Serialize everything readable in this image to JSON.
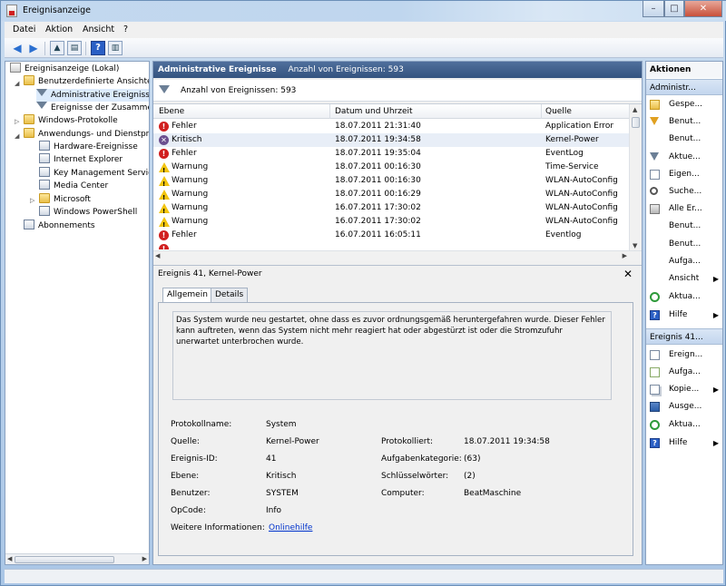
{
  "window": {
    "title": "Ereignisanzeige"
  },
  "menu": [
    "Datei",
    "Aktion",
    "Ansicht",
    "?"
  ],
  "tree": {
    "root": "Ereignisanzeige (Lokal)",
    "custom_views": "Benutzerdefinierte Ansichten",
    "admin_events": "Administrative Ereignisse",
    "summary_events": "Ereignisse der Zusammen",
    "windows_logs": "Windows-Protokolle",
    "app_services": "Anwendungs- und Dienstpro",
    "hardware": "Hardware-Ereignisse",
    "ie": "Internet Explorer",
    "kms": "Key Management Service",
    "media_center": "Media Center",
    "microsoft": "Microsoft",
    "powershell": "Windows PowerShell",
    "subscriptions": "Abonnements"
  },
  "center": {
    "header_title": "Administrative Ereignisse",
    "header_count": "Anzahl von Ereignissen: 593",
    "filter_text": "Anzahl von Ereignissen: 593",
    "columns": {
      "level": "Ebene",
      "datetime": "Datum und Uhrzeit",
      "source": "Quelle"
    },
    "rows": [
      {
        "level": "Fehler",
        "type": "error",
        "datetime": "18.07.2011 21:31:40",
        "source": "Application Error"
      },
      {
        "level": "Kritisch",
        "type": "critical",
        "datetime": "18.07.2011 19:34:58",
        "source": "Kernel-Power"
      },
      {
        "level": "Fehler",
        "type": "error",
        "datetime": "18.07.2011 19:35:04",
        "source": "EventLog"
      },
      {
        "level": "Warnung",
        "type": "warn",
        "datetime": "18.07.2011 00:16:30",
        "source": "Time-Service"
      },
      {
        "level": "Warnung",
        "type": "warn",
        "datetime": "18.07.2011 00:16:30",
        "source": "WLAN-AutoConfig"
      },
      {
        "level": "Warnung",
        "type": "warn",
        "datetime": "18.07.2011 00:16:29",
        "source": "WLAN-AutoConfig"
      },
      {
        "level": "Warnung",
        "type": "warn",
        "datetime": "16.07.2011 17:30:02",
        "source": "WLAN-AutoConfig"
      },
      {
        "level": "Warnung",
        "type": "warn",
        "datetime": "16.07.2011 17:30:02",
        "source": "WLAN-AutoConfig"
      },
      {
        "level": "Fehler",
        "type": "error",
        "datetime": "16.07.2011 16:05:11",
        "source": "Eventlog"
      }
    ]
  },
  "detail": {
    "title": "Ereignis 41, Kernel-Power",
    "tab_general": "Allgemein",
    "tab_details": "Details",
    "description": "Das System wurde neu gestartet, ohne dass es zuvor ordnungsgemäß heruntergefahren wurde. Dieser Fehler kann auftreten, wenn das System nicht mehr reagiert hat oder abgestürzt ist oder die Stromzufuhr unerwartet unterbrochen wurde.",
    "log_name_label": "Protokollname:",
    "log_name": "System",
    "source_label": "Quelle:",
    "source": "Kernel-Power",
    "logged_label": "Protokolliert:",
    "logged": "18.07.2011 19:34:58",
    "event_id_label": "Ereignis-ID:",
    "event_id": "41",
    "task_label": "Aufgabenkategorie:",
    "task": "(63)",
    "level_label": "Ebene:",
    "level": "Kritisch",
    "keywords_label": "Schlüsselwörter:",
    "keywords": "(2)",
    "user_label": "Benutzer:",
    "user": "SYSTEM",
    "computer_label": "Computer:",
    "computer": "BeatMaschine",
    "opcode_label": "OpCode:",
    "opcode": "Info",
    "more_info_label": "Weitere Informationen:",
    "more_info_link": "Onlinehilfe"
  },
  "actions": {
    "header": "Aktionen",
    "section1": "Administr...",
    "items1": [
      {
        "label": "Gespe...",
        "icon": "folder-icon"
      },
      {
        "label": "Benut...",
        "icon": "filter-icon"
      },
      {
        "label": "Benut...",
        "icon": "none"
      },
      {
        "label": "Aktue...",
        "icon": "filter-icon"
      },
      {
        "label": "Eigen...",
        "icon": "properties-icon"
      },
      {
        "label": "Suche...",
        "icon": "search-icon"
      },
      {
        "label": "Alle Er...",
        "icon": "save-icon"
      },
      {
        "label": "Benut...",
        "icon": "none"
      },
      {
        "label": "Benut...",
        "icon": "none"
      },
      {
        "label": "Aufga...",
        "icon": "none"
      },
      {
        "label": "Ansicht",
        "icon": "none",
        "submenu": true
      },
      {
        "label": "Aktua...",
        "icon": "refresh-icon"
      },
      {
        "label": "Hilfe",
        "icon": "help-icon",
        "submenu": true
      }
    ],
    "section2": "Ereignis 41...",
    "items2": [
      {
        "label": "Ereign...",
        "icon": "properties-icon"
      },
      {
        "label": "Aufga...",
        "icon": "task-icon"
      },
      {
        "label": "Kopie...",
        "icon": "copy-icon",
        "submenu": true
      },
      {
        "label": "Ausge...",
        "icon": "save-icon"
      },
      {
        "label": "Aktua...",
        "icon": "refresh-icon"
      },
      {
        "label": "Hilfe",
        "icon": "help-icon",
        "submenu": true
      }
    ]
  }
}
